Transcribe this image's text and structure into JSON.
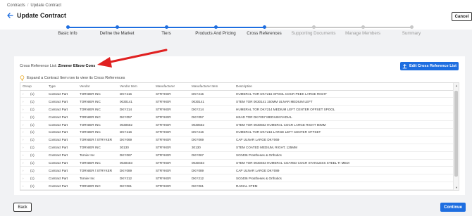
{
  "breadcrumb": {
    "root": "Contracts",
    "separator": "/",
    "current": "Update Contract"
  },
  "header": {
    "title": "Update Contract",
    "cancel_label": "Cancel",
    "back_icon": "arrow-left-icon"
  },
  "stepper": {
    "active_color": "#1e6ee0",
    "inactive_color": "#c8c8c8",
    "steps": [
      {
        "label": "Basic Info",
        "done": true
      },
      {
        "label": "Define the Market",
        "done": true
      },
      {
        "label": "Tiers",
        "done": true
      },
      {
        "label": "Products And Pricing",
        "done": true
      },
      {
        "label": "Cross References",
        "done": true
      },
      {
        "label": "Supporting Documents",
        "done": false
      },
      {
        "label": "Manage Members",
        "done": false
      },
      {
        "label": "Summary",
        "done": false
      }
    ]
  },
  "cross_ref": {
    "list_label": "Cross Reference List:",
    "list_name": "Zimmer Elbow Cons",
    "edit_button": "Edit Cross Reference List",
    "hint": "Expand a Contract Item row to view its Cross References"
  },
  "table": {
    "columns": [
      "Group",
      "Type",
      "Vendor",
      "Vendor Item",
      "Manufacturer",
      "Manufacturer Item",
      "Description"
    ],
    "rows": [
      [
        "(1)",
        "Contract Part",
        "TORNIER INC",
        "DKY215",
        "STRYKER",
        "DKY215",
        "HUMERAL TOR DKY215 SPOOL COCR PEEK LARGE RIGHT"
      ],
      [
        "(1)",
        "Contract Part",
        "TORNIER INC",
        "0030141",
        "STRYKER",
        "0030141",
        "STEM TOR 0030141 150MM ULNAR MEDIUM LEFT"
      ],
      [
        "(1)",
        "Contract Part",
        "TORNIER INC",
        "DKY214",
        "STRYKER",
        "DKY214",
        "HUMERAL TOR DKY214 MEDIUM LEFT CENTER OFFSET SPOOL"
      ],
      [
        "(1)",
        "Contract Part",
        "TORNIER INC",
        "DKY057",
        "STRYKER",
        "DKY057",
        "HEAD TOR DKY057 MEDIUM RADIAL"
      ],
      [
        "(1)",
        "Contract Part",
        "TORNIER INC",
        "0030502",
        "STRYKER",
        "0030502",
        "STEM TOR 0030502 HUMERAL COCR LARGE RIGHT 80MM"
      ],
      [
        "(1)",
        "Contract Part",
        "TORNIER INC",
        "DKY216",
        "STRYKER",
        "DKY216",
        "HUMERAL TOR DKY216 LARGE LEFT CENTER OFFSET"
      ],
      [
        "(1)",
        "Contract Part",
        "TORNIER / STRYKER",
        "DKY069",
        "STRYKER",
        "DKY069",
        "CAP ULNAR LARGE DKY069"
      ],
      [
        "(1)",
        "Contract Part",
        "TORNIER INC",
        "30130",
        "STRYKER",
        "30130",
        "STEM COATED MEDIUM, RIGHT, 125MM"
      ],
      [
        "(1)",
        "Contract Part",
        "Tornier Inc",
        "DKY067",
        "STRYKER",
        "DKY067",
        "SC0406 Prostheses & Orthotics"
      ],
      [
        "(1)",
        "Contract Part",
        "TORNIER INC",
        "0030403",
        "STRYKER",
        "0030403",
        "STEM TOR 0030403 HUMERAL COATED COCR STAINLESS STEEL TI MEDI"
      ],
      [
        "(1)",
        "Contract Part",
        "TORNIER / STRYKER",
        "DKY089",
        "STRYKER",
        "DKY089",
        "CAP ULNAR LARGE DKY089"
      ],
      [
        "(1)",
        "Contract Part",
        "Tornier Inc",
        "DKY212",
        "STRYKER",
        "DKY212",
        "SC0406 Prostheses & Orthotics"
      ],
      [
        "(1)",
        "Contract Part",
        "TORNIER INC",
        "DKY061",
        "STRYKER",
        "DKY061",
        "RADIAL STEM"
      ]
    ]
  },
  "footer": {
    "back_label": "Back",
    "continue_label": "Continue"
  },
  "icons": {
    "edit": "upload-icon",
    "hint": "lightbulb-icon",
    "row_toggle": "chevron-right-icon"
  },
  "colors": {
    "primary": "#1e6ee0",
    "annotation_arrow": "#e02020"
  }
}
